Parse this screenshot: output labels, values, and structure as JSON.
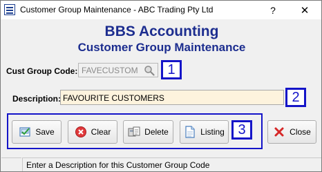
{
  "window": {
    "title": "Customer Group Maintenance - ABC Trading Pty Ltd",
    "help_label": "?",
    "close_label": "✕"
  },
  "header": {
    "title": "BBS Accounting",
    "subtitle": "Customer Group Maintenance"
  },
  "form": {
    "code_label": "Cust Group Code:",
    "code_value": "FAVECUSTOM",
    "description_label": "Description:",
    "description_value": "FAVOURITE CUSTOMERS"
  },
  "callouts": {
    "one": "1",
    "two": "2",
    "three": "3"
  },
  "buttons": {
    "save": "Save",
    "clear": "Clear",
    "delete": "Delete",
    "listing": "Listing",
    "close": "Close"
  },
  "status": {
    "message": "Enter a Description for this Customer Group Code"
  },
  "colors": {
    "heading": "#1c2d8f",
    "callout_border": "#1414c8",
    "description_bg": "#fdf3dd"
  },
  "icons": {
    "app": "ledger-icon",
    "search": "magnifier-icon",
    "save": "save-icon",
    "clear": "clear-icon",
    "delete": "delete-icon",
    "listing": "document-icon",
    "close": "close-icon"
  }
}
